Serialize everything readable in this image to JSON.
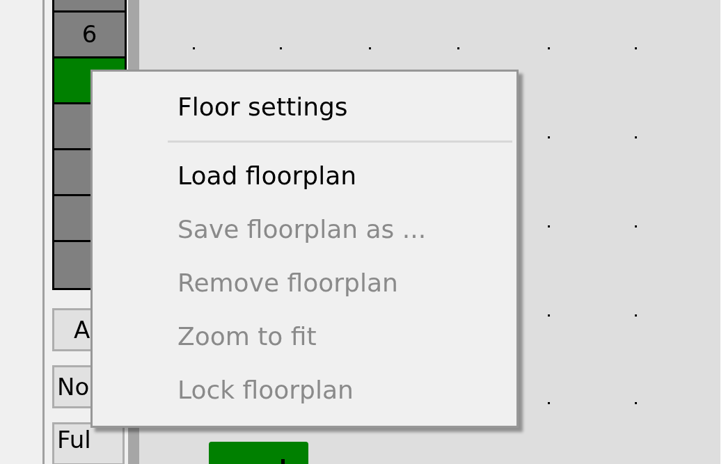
{
  "floors": [
    {
      "label": "6",
      "selected": false
    },
    {
      "selected": true
    },
    {
      "selected": false
    },
    {
      "selected": false
    },
    {
      "selected": false
    },
    {
      "selected": false
    }
  ],
  "side_buttons": [
    "A",
    "No",
    "Ful"
  ],
  "context_menu": {
    "items": [
      {
        "kind": "item",
        "label": "Floor settings",
        "disabled": false
      },
      {
        "kind": "separator"
      },
      {
        "kind": "item",
        "label": "Load floorplan",
        "disabled": false
      },
      {
        "kind": "item",
        "label": "Save floorplan as ...",
        "disabled": true
      },
      {
        "kind": "item",
        "label": "Remove floorplan",
        "disabled": true
      },
      {
        "kind": "item",
        "label": "Zoom to fit",
        "disabled": true
      },
      {
        "kind": "item",
        "label": "Lock floorplan",
        "disabled": true
      }
    ]
  }
}
